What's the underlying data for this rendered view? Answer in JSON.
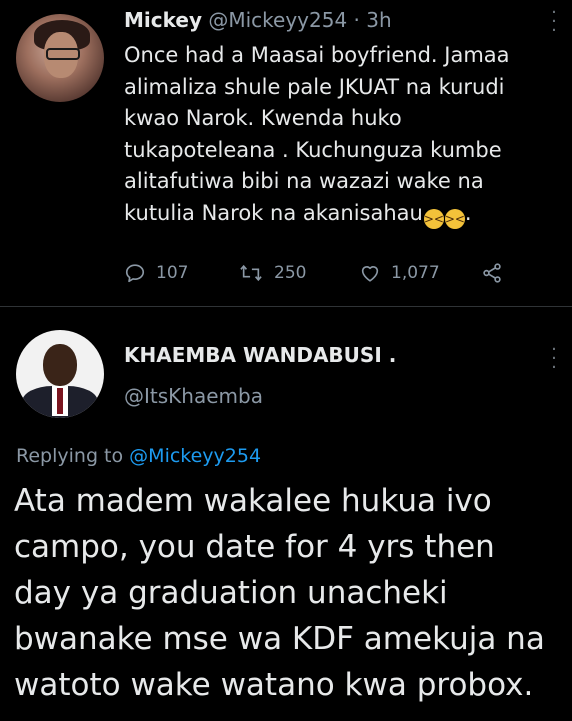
{
  "tweet": {
    "author_name": "Mickey",
    "author_handle": "@Mickeyy254",
    "separator": "·",
    "time": "3h",
    "body_lines": [
      "Once had a Maasai boyfriend. Jamaa",
      "alimaliza shule pale JKUAT na kurudi",
      "kwao Narok. Kwenda huko",
      "tukapoteleana . Kuchunguza kumbe",
      "alitafutiwa bibi na wazazi wake na",
      "kutulia Narok na akanisahau"
    ],
    "body_end": ".",
    "emoji_icon": "tired-face-emoji",
    "actions": {
      "reply_count": "107",
      "retweet_count": "250",
      "like_count": "1,077"
    }
  },
  "reply": {
    "author_name": "KHAEMBA WANDABUSI .",
    "author_handle": "@ItsKhaemba",
    "replying_prefix": "Replying to",
    "replying_handle": "@Mickeyy254",
    "body_lines": [
      "Ata madem wakalee hukua ivo",
      "campo, you date for 4 yrs then",
      "day ya graduation unacheki",
      "bwanake mse wa KDF amekuja na",
      "watoto wake watano kwa probox."
    ]
  },
  "colors": {
    "background": "#000000",
    "text": "#e7e9ea",
    "secondary": "#8b98a5",
    "link": "#1d9bf0",
    "divider": "#2f3336"
  }
}
